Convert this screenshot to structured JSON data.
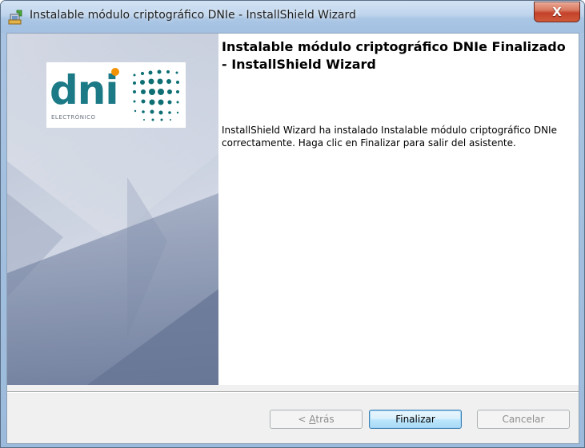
{
  "window": {
    "title": "Instalable módulo criptográfico DNIe - InstallShield Wizard",
    "close_glyph": "X"
  },
  "logo": {
    "brand": "dni",
    "subtitle": "ELECTRÓNICO",
    "colors": {
      "text": "#1b7a86",
      "dot": "#f39200",
      "dots": "#0d6e74"
    }
  },
  "content": {
    "heading": "Instalable módulo criptográfico DNIe Finalizado - InstallShield Wizard",
    "body": "InstallShield Wizard ha instalado Instalable módulo criptográfico DNIe correctamente. Haga clic en Finalizar para salir del asistente."
  },
  "buttons": {
    "back_prefix": "< ",
    "back_accel": "A",
    "back_rest": "trás",
    "finish": "Finalizar",
    "cancel": "Cancelar"
  },
  "icons": {
    "app": "installer-icon",
    "close": "close-icon"
  }
}
